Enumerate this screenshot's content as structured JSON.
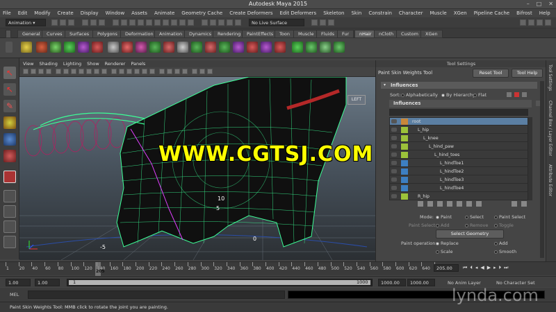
{
  "window": {
    "title": "Autodesk Maya 2015",
    "buttons": [
      "–",
      "□",
      "✕"
    ]
  },
  "menus": [
    "File",
    "Edit",
    "Modify",
    "Create",
    "Display",
    "Window",
    "Assets",
    "Animate",
    "Geometry Cache",
    "Create Deformers",
    "Edit Deformers",
    "Skeleton",
    "Skin",
    "Constrain",
    "Character",
    "Muscle",
    "XGen",
    "Pipeline Cache",
    "Bifrost",
    "Help"
  ],
  "status": {
    "menuset": "Animation",
    "live_surface": "No Live Surface"
  },
  "shelf_tabs": [
    "General",
    "Curves",
    "Surfaces",
    "Polygons",
    "Deformation",
    "Animation",
    "Dynamics",
    "Rendering",
    "PaintEffects",
    "Toon",
    "Muscle",
    "Fluids",
    "Fur",
    "nHair",
    "nCloth",
    "Custom",
    "XGen"
  ],
  "shelf_active": "nHair",
  "viewport": {
    "menus": [
      "View",
      "Shading",
      "Lighting",
      "Show",
      "Renderer",
      "Panels"
    ],
    "cube_label": "LEFT",
    "grid_labels": [
      "10",
      "5",
      "0",
      "-5"
    ],
    "watermark": "WWW.CGTSJ.COM"
  },
  "tool_settings": {
    "header": "Tool Settings",
    "tool_name": "Paint Skin Weights Tool",
    "reset_label": "Reset Tool",
    "help_label": "Tool Help",
    "influences_label": "Influences",
    "sort_label": "Sort:",
    "sort_options": [
      "Alphabetically",
      "By Hierarchy",
      "Flat"
    ],
    "list_header": "Influences",
    "joints": [
      {
        "name": "root",
        "color": "#c8883a",
        "selected": true
      },
      {
        "name": "L_hip",
        "color": "#9cc23a"
      },
      {
        "name": "L_knee",
        "color": "#9cc23a"
      },
      {
        "name": "L_hind_paw",
        "color": "#9cc23a"
      },
      {
        "name": "L_hind_toes",
        "color": "#9cc23a"
      },
      {
        "name": "L_hindToe1",
        "color": "#3d7fc2"
      },
      {
        "name": "L_hindToe2",
        "color": "#3d7fc2"
      },
      {
        "name": "L_hindToe3",
        "color": "#3d7fc2"
      },
      {
        "name": "L_hindToe4",
        "color": "#3d7fc2"
      },
      {
        "name": "R_hip",
        "color": "#9cc23a"
      }
    ],
    "mode_label": "Mode:",
    "mode_options": [
      "Paint",
      "Select",
      "Paint Select"
    ],
    "paint_select_label": "Paint Select:",
    "paint_select_options": [
      "Add",
      "Remove",
      "Toggle"
    ],
    "select_geometry_label": "Select Geometry",
    "paint_op_label": "Paint operation:",
    "paint_op_options": [
      "Replace",
      "Add",
      "Scale",
      "Smooth"
    ]
  },
  "side_tabs": [
    "Tool Settings",
    "Channel Box / Layer Editor",
    "Attribute Editor"
  ],
  "timeline": {
    "ticks": [
      "1",
      "20",
      "40",
      "60",
      "80",
      "100",
      "120",
      "140",
      "160",
      "180",
      "200",
      "220",
      "240",
      "260",
      "280",
      "300",
      "320",
      "340",
      "360",
      "380",
      "400",
      "420",
      "440",
      "460",
      "480",
      "500",
      "520",
      "540",
      "560",
      "580",
      "600",
      "620",
      "640",
      "660"
    ],
    "current_frame": "205",
    "current_field": "205.00"
  },
  "range": {
    "start": "1.00",
    "start2": "1.00",
    "range_start": "1",
    "range_end": "1000",
    "end": "1000.00",
    "end2": "1000.00",
    "anim_layer": "No Anim Layer",
    "character_set": "No Character Set"
  },
  "mel_label": "MEL",
  "help_text": "Paint Skin Weights Tool: MMB click to rotate the joint you are painting.",
  "brand": "lynda.com"
}
